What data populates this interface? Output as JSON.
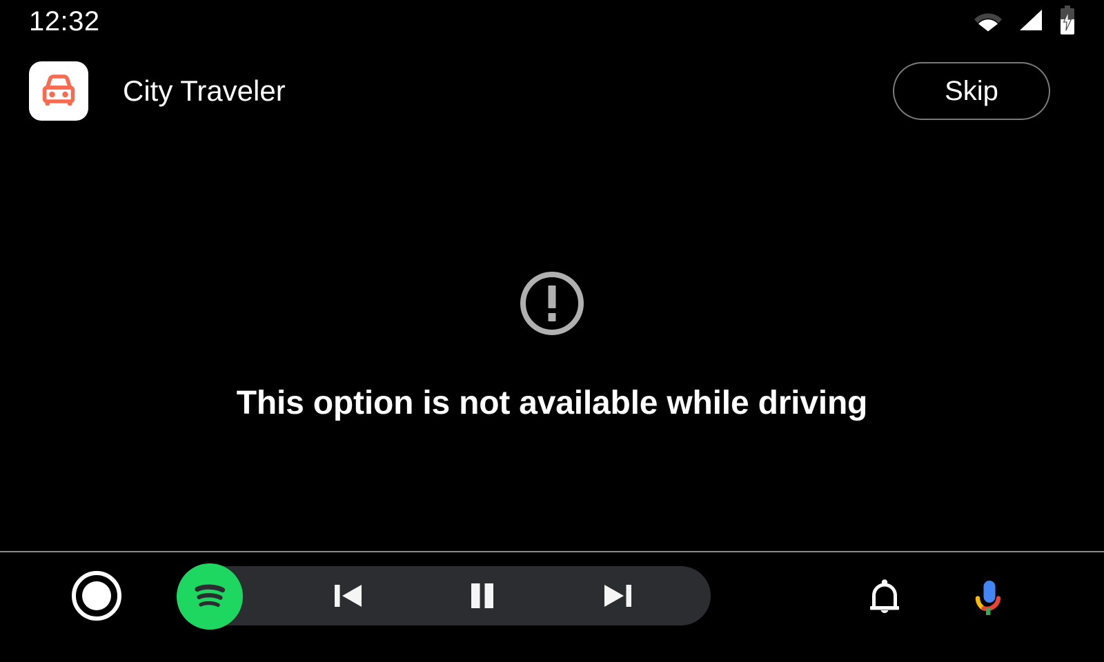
{
  "status_bar": {
    "clock": "12:32",
    "icons": [
      {
        "name": "wifi-icon",
        "label": "Wi-Fi"
      },
      {
        "name": "cellular-signal-icon",
        "label": "Cellular signal"
      },
      {
        "name": "battery-charging-icon",
        "label": "Battery charging"
      }
    ]
  },
  "app_header": {
    "app_icon_name": "car-app-icon",
    "title": "City Traveler",
    "skip_label": "Skip"
  },
  "main": {
    "error_icon_name": "error-exclamation-circle-icon",
    "message": "This option is not available while driving"
  },
  "nav_bar": {
    "home_label": "Home",
    "media_app_name": "spotify-icon",
    "previous_label": "Previous track",
    "pause_label": "Pause",
    "next_label": "Next track",
    "notification_label": "Notifications",
    "assistant_label": "Google Assistant"
  },
  "colors": {
    "background": "#000000",
    "text_primary": "#ffffff",
    "warning_gray": "#b0b0b0",
    "divider": "#8a8a8a",
    "media_pill": "#2b2d30",
    "spotify_green": "#1ed760",
    "app_icon_accent": "#fa6a4e",
    "assistant_blue": "#4285f4",
    "assistant_red": "#ea4335",
    "assistant_yellow": "#fbbc04",
    "assistant_green": "#34a853",
    "skip_border": "#7a7a7a"
  }
}
